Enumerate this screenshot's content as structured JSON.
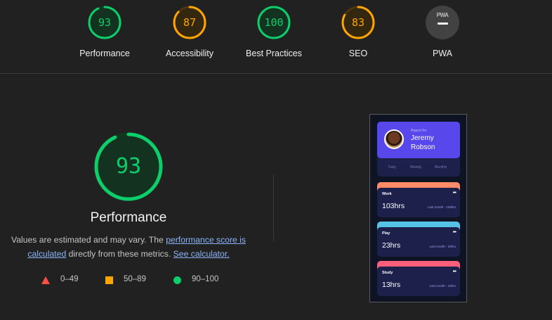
{
  "gauges": [
    {
      "score": "93",
      "label": "Performance",
      "color": "#0cce6b",
      "fraction": 0.93
    },
    {
      "score": "87",
      "label": "Accessibility",
      "color": "#ffa400",
      "fraction": 0.87
    },
    {
      "score": "100",
      "label": "Best Practices",
      "color": "#0cce6b",
      "fraction": 1.0
    },
    {
      "score": "83",
      "label": "SEO",
      "color": "#ffa400",
      "fraction": 0.83
    }
  ],
  "pwa": {
    "badge": "PWA",
    "label": "PWA"
  },
  "main": {
    "score": "93",
    "fraction": 0.93,
    "title": "Performance",
    "desc_prefix": "Values are estimated and may vary. The ",
    "score_link": "performance score is calculated",
    "desc_mid": " directly from these metrics. ",
    "calc_link": "See calculator."
  },
  "legend": {
    "fail": "0–49",
    "average": "50–89",
    "pass": "90–100"
  },
  "screenshot": {
    "report_for": "Report for",
    "name_line1": "Jeremy",
    "name_line2": "Robson",
    "periods": [
      "Daily",
      "Weekly",
      "Monthly"
    ],
    "cards": [
      {
        "title": "Work",
        "hours": "103hrs",
        "last": "Last month - 128hrs",
        "color": "#ff8c66"
      },
      {
        "title": "Play",
        "hours": "23hrs",
        "last": "Last month - 29hrs",
        "color": "#56c2e6"
      },
      {
        "title": "Study",
        "hours": "13hrs",
        "last": "Last month - 16hrs",
        "color": "#ff5e7d"
      }
    ]
  },
  "colors": {
    "pass": "#0cce6b",
    "average": "#ffa400",
    "fail": "#ff4e42",
    "link": "#8ab4f8"
  }
}
